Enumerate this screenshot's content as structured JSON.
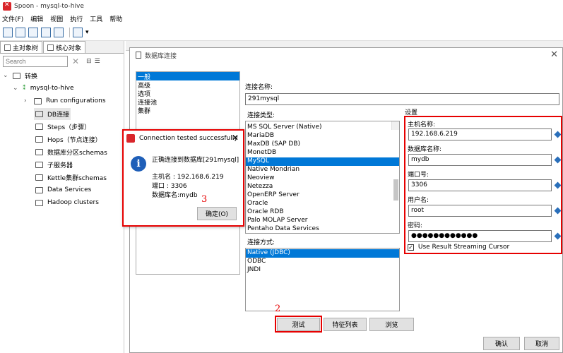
{
  "window": {
    "title": "Spoon - mysql-to-hive"
  },
  "menu": [
    "文件(F)",
    "编辑",
    "视图",
    "执行",
    "工具",
    "帮助"
  ],
  "left_panel": {
    "tabs": [
      "主对象树",
      "核心对象"
    ],
    "search_placeholder": "Search",
    "tree": {
      "root": "转换",
      "transform": "mysql-to-hive",
      "items": [
        "Run configurations",
        "DB连接",
        "Steps（步骤）",
        "Hops（节点连接）",
        "数据库分区schemas",
        "子服务器",
        "Kettle集群schemas",
        "Data Services",
        "Hadoop clusters"
      ]
    }
  },
  "dialog": {
    "title": "数据库连接",
    "categories": [
      "一般",
      "高级",
      "选项",
      "连接池",
      "集群"
    ],
    "conn_name_label": "连接名称:",
    "conn_name_value": "291mysql",
    "conn_type_label": "连接类型:",
    "conn_types": [
      "MS SQL Server (Native)",
      "MariaDB",
      "MaxDB (SAP DB)",
      "MonetDB",
      "MySQL",
      "Native Mondrian",
      "Neoview",
      "Netezza",
      "OpenERP Server",
      "Oracle",
      "Oracle RDB",
      "Palo MOLAP Server",
      "Pentaho Data Services"
    ],
    "conn_type_selected": "MySQL",
    "access_label": "连接方式:",
    "access_types": [
      "Native (JDBC)",
      "ODBC",
      "JNDI"
    ],
    "settings": {
      "label": "设置",
      "host_label": "主机名称:",
      "host_value": "192.168.6.219",
      "db_label": "数据库名称:",
      "db_value": "mydb",
      "port_label": "端口号:",
      "port_value": "3306",
      "user_label": "用户名:",
      "user_value": "root",
      "password_label": "密码:",
      "password_value": "●●●●●●●●●●●●",
      "streaming_label": "Use Result Streaming Cursor"
    },
    "buttons": {
      "test": "测试",
      "features": "特征列表",
      "explore": "浏览",
      "ok": "确认",
      "cancel": "取消"
    }
  },
  "popup": {
    "title": "Connection tested successfully",
    "message": "正确连接到数据库[291mysql]",
    "host_line": "主机名 : 192.168.6.219",
    "port_line": "端口 : 3306",
    "db_line": "数据库名:mydb",
    "ok": "确定(O)"
  },
  "annotations": {
    "step2": "2",
    "step3": "3"
  }
}
